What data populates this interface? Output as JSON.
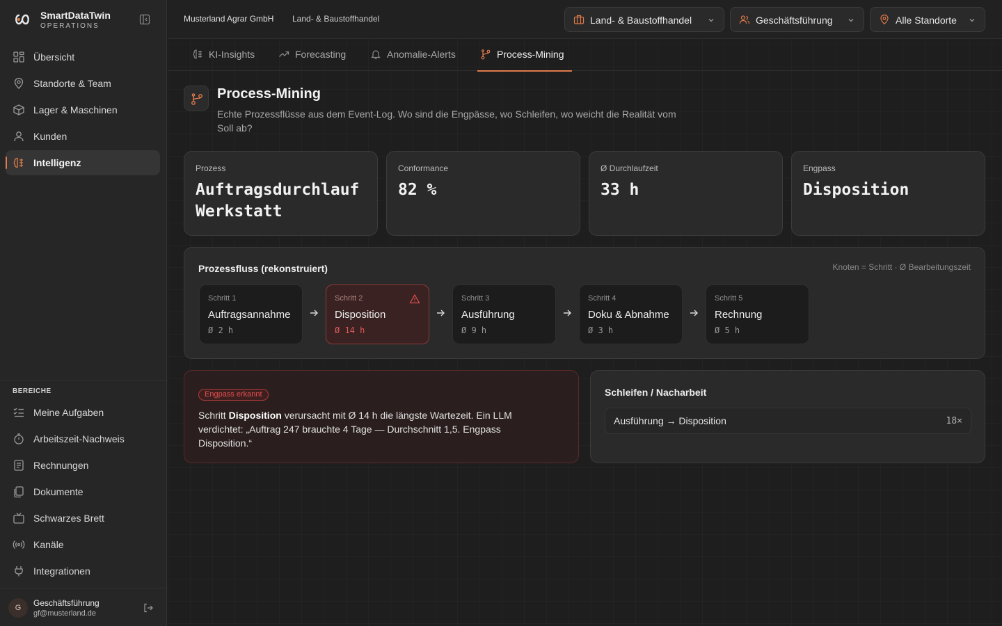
{
  "brand": {
    "name": "SmartDataTwin",
    "subtitle": "OPERATIONS"
  },
  "sidebar": {
    "main_items": [
      {
        "label": "Übersicht",
        "icon": "grid-icon"
      },
      {
        "label": "Standorte & Team",
        "icon": "map-pin-icon"
      },
      {
        "label": "Lager & Maschinen",
        "icon": "box-icon"
      },
      {
        "label": "Kunden",
        "icon": "user-icon"
      },
      {
        "label": "Intelligenz",
        "icon": "brain-icon",
        "active": true
      }
    ],
    "section_label": "BEREICHE",
    "section_items": [
      {
        "label": "Meine Aufgaben",
        "icon": "checklist-icon"
      },
      {
        "label": "Arbeitszeit-Nachweis",
        "icon": "stopwatch-icon"
      },
      {
        "label": "Rechnungen",
        "icon": "receipt-icon"
      },
      {
        "label": "Dokumente",
        "icon": "documents-icon"
      },
      {
        "label": "Schwarzes Brett",
        "icon": "tv-icon"
      },
      {
        "label": "Kanäle",
        "icon": "broadcast-icon"
      },
      {
        "label": "Integrationen",
        "icon": "plug-icon"
      }
    ],
    "user": {
      "initial": "G",
      "name": "Geschäftsführung",
      "email": "gf@musterland.de"
    }
  },
  "topbar": {
    "breadcrumb": [
      "Musterland Agrar GmbH",
      "Land- & Baustoffhandel"
    ],
    "dropdowns": [
      {
        "label": "Land- & Baustoffhandel",
        "icon": "briefcase-icon"
      },
      {
        "label": "Geschäftsführung",
        "icon": "users-icon"
      },
      {
        "label": "Alle Standorte",
        "icon": "map-pin-icon"
      }
    ]
  },
  "tabs": [
    {
      "label": "KI-Insights",
      "icon": "brain-icon"
    },
    {
      "label": "Forecasting",
      "icon": "trend-icon"
    },
    {
      "label": "Anomalie-Alerts",
      "icon": "bell-icon"
    },
    {
      "label": "Process-Mining",
      "icon": "branch-icon",
      "active": true
    }
  ],
  "page": {
    "title": "Process-Mining",
    "description": "Echte Prozessflüsse aus dem Event-Log. Wo sind die Engpässe, wo Schleifen, wo weicht die Realität vom Soll ab?"
  },
  "kpis": [
    {
      "label": "Prozess",
      "value": "Auftragsdurchlauf Werkstatt"
    },
    {
      "label": "Conformance",
      "value": "82 %"
    },
    {
      "label": "Ø Durchlaufzeit",
      "value": "33 h"
    },
    {
      "label": "Engpass",
      "value": "Disposition"
    }
  ],
  "flow": {
    "title": "Prozessfluss (rekonstruiert)",
    "legend": "Knoten = Schritt · Ø Bearbeitungszeit",
    "steps": [
      {
        "number": "Schritt 1",
        "name": "Auftragsannahme",
        "time": "Ø 2 h"
      },
      {
        "number": "Schritt 2",
        "name": "Disposition",
        "time": "Ø 14 h",
        "bottleneck": true
      },
      {
        "number": "Schritt 3",
        "name": "Ausführung",
        "time": "Ø 9 h"
      },
      {
        "number": "Schritt 4",
        "name": "Doku & Abnahme",
        "time": "Ø 3 h"
      },
      {
        "number": "Schritt 5",
        "name": "Rechnung",
        "time": "Ø 5 h"
      }
    ]
  },
  "alert": {
    "badge": "Engpass erkannt",
    "text_prefix": "Schritt ",
    "text_bold": "Disposition",
    "text_suffix": " verursacht mit Ø 14 h die längste Wartezeit. Ein LLM verdichtet: „Auftrag 247 brauchte 4 Tage — Durchschnitt 1,5. Engpass Disposition.“"
  },
  "loops": {
    "title": "Schleifen / Nacharbeit",
    "items": [
      {
        "name": "Ausführung → Disposition",
        "count": "18×"
      }
    ]
  },
  "colors": {
    "accent": "#e07a4a",
    "alert_red": "#e05050",
    "background": "#1e1e1e",
    "card": "#2a2a2a"
  }
}
